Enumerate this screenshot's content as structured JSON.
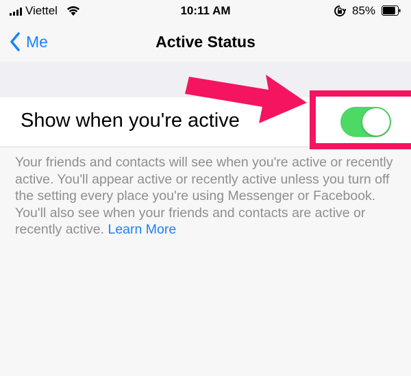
{
  "status_bar": {
    "carrier": "Viettel",
    "time": "10:11 AM",
    "battery_percent": "85%",
    "battery_level": 0.85,
    "icons": [
      "signal-icon",
      "wifi-icon",
      "rotation-lock-icon",
      "battery-icon"
    ]
  },
  "nav": {
    "back_label": "Me",
    "title": "Active Status"
  },
  "setting": {
    "label": "Show when you're active",
    "toggle_on": true
  },
  "description": {
    "text": "Your friends and contacts will see when you're active or recently active. You'll appear active or recently active unless you turn off the setting every place you're using Messenger or Facebook. You'll also see when your friends and contacts are active or recently active. ",
    "link": "Learn More"
  },
  "colors": {
    "accent_blue": "#1a82fb",
    "toggle_green": "#4cd964",
    "annotation_pink": "#f5145f",
    "secondary_text": "#8e8e93"
  }
}
